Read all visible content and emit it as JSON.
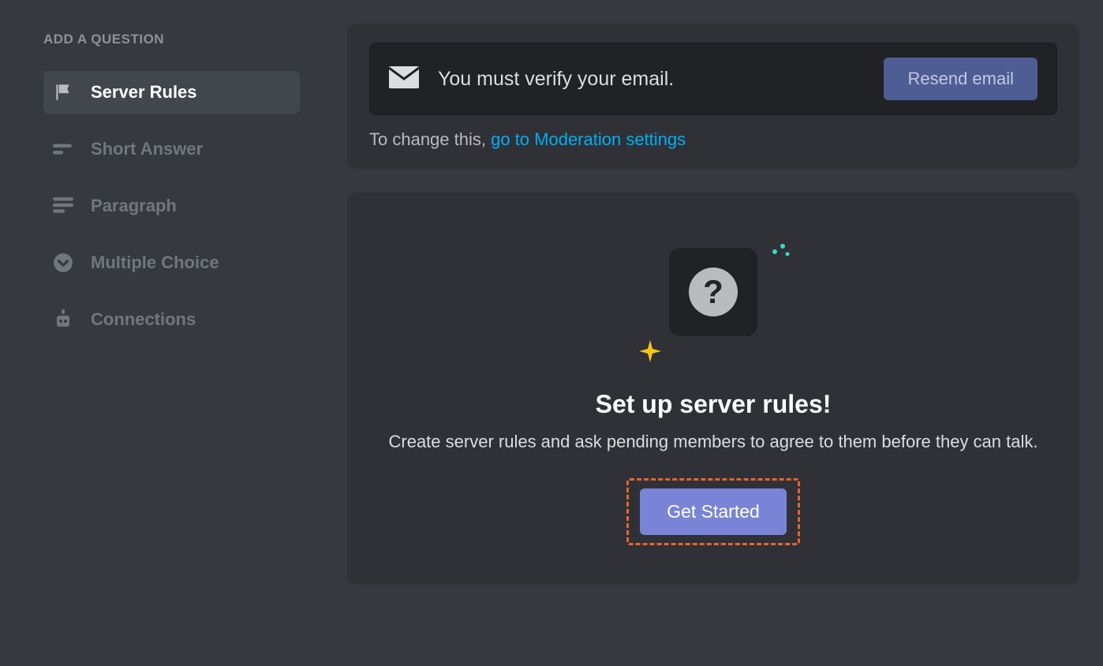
{
  "sidebar": {
    "heading": "ADD A QUESTION",
    "items": [
      {
        "label": "Server Rules",
        "icon": "flag-icon",
        "active": true
      },
      {
        "label": "Short Answer",
        "icon": "short-lines-icon",
        "active": false
      },
      {
        "label": "Paragraph",
        "icon": "paragraph-lines-icon",
        "active": false
      },
      {
        "label": "Multiple Choice",
        "icon": "chevron-circle-icon",
        "active": false
      },
      {
        "label": "Connections",
        "icon": "robot-icon",
        "active": false
      }
    ]
  },
  "verify": {
    "message": "You must verify your email.",
    "resend_label": "Resend email",
    "change_prefix": "To change this, ",
    "change_link": "go to Moderation settings"
  },
  "setup": {
    "title": "Set up server rules!",
    "description": "Create server rules and ask pending members to agree to them before they can talk.",
    "cta": "Get Started",
    "question_glyph": "?"
  }
}
